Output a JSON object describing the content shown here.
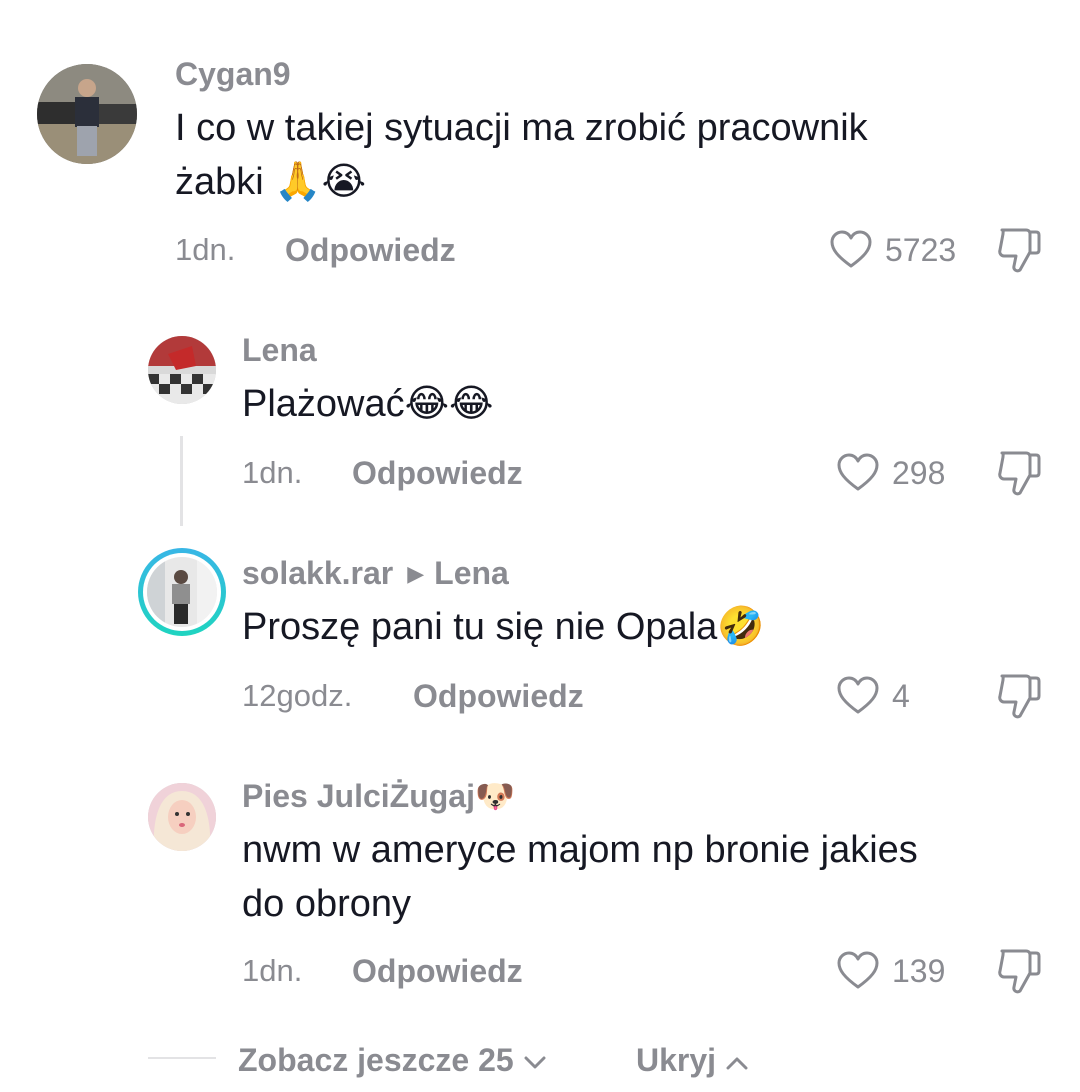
{
  "comments": [
    {
      "username": "Cygan9",
      "text": "I co w takiej sytuacji ma zrobić pracownik\nżabki 🙏😭",
      "time": "1dn.",
      "reply_label": "Odpowiedz",
      "likes": "5723"
    },
    {
      "username": "Lena",
      "text": "Plażować😂😂",
      "time": "1dn.",
      "reply_label": "Odpowiedz",
      "likes": "298"
    },
    {
      "username": "solakk.rar",
      "reply_to": "Lena",
      "text": "Proszę pani tu się nie Opala🤣",
      "time": "12godz.",
      "reply_label": "Odpowiedz",
      "likes": "4"
    },
    {
      "username": "Pies JulciŻugaj🐶",
      "text": "nwm w ameryce majom np bronie jakies\ndo obrony",
      "time": "1dn.",
      "reply_label": "Odpowiedz",
      "likes": "139"
    }
  ],
  "footer": {
    "more_label": "Zobacz jeszcze 25",
    "hide_label": "Ukryj"
  },
  "icons": [
    "heart-icon",
    "dislike-icon",
    "chevron-down-icon",
    "chevron-up-icon",
    "play-arrow-icon"
  ],
  "colors": {
    "text": "#161823",
    "secondary": "#8a8b91",
    "story_ring": "#2bc7d9"
  }
}
